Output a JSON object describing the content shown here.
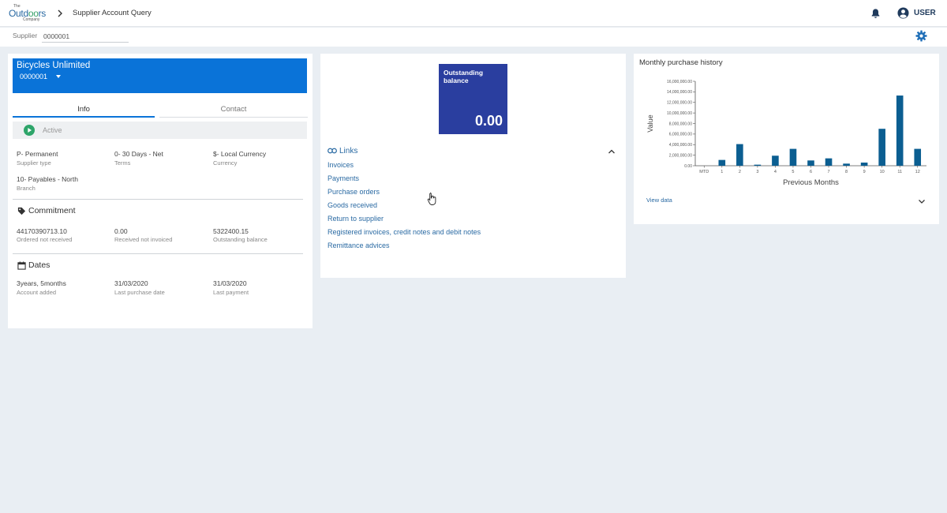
{
  "header": {
    "logo_small": "The",
    "logo_main_a": "Outd",
    "logo_main_b": "oo",
    "logo_main_c": "rs",
    "logo_sub": "Company",
    "page_title": "Supplier Account Query",
    "user_label": "USER"
  },
  "supplier_bar": {
    "label": "Supplier",
    "value": "0000001"
  },
  "supplier": {
    "name": "Bicycles Unlimited",
    "id": "0000001",
    "tabs": [
      {
        "label": "Info"
      },
      {
        "label": "Contact"
      }
    ],
    "status": "Active",
    "fields": [
      {
        "value": "P- Permanent",
        "label": "Supplier type"
      },
      {
        "value": "0- 30 Days - Net",
        "label": "Terms"
      },
      {
        "value": "$- Local Currency",
        "label": "Currency"
      },
      {
        "value": "10- Payables - North",
        "label": "Branch"
      }
    ],
    "commitment": {
      "title": "Commitment",
      "items": [
        {
          "value": "44170390713.10",
          "label": "Ordered not received"
        },
        {
          "value": "0.00",
          "label": "Received not invoiced"
        },
        {
          "value": "5322400.15",
          "label": "Outstanding balance"
        }
      ]
    },
    "dates": {
      "title": "Dates",
      "items": [
        {
          "value": "3years, 5months",
          "label": "Account added"
        },
        {
          "value": "31/03/2020",
          "label": "Last purchase date"
        },
        {
          "value": "31/03/2020",
          "label": "Last payment"
        }
      ]
    }
  },
  "balance": {
    "title": "Outstanding balance",
    "value": "0.00",
    "color": "#2a3e9f"
  },
  "links": {
    "title": "Links",
    "items": [
      {
        "label": "Invoices"
      },
      {
        "label": "Payments"
      },
      {
        "label": "Purchase orders"
      },
      {
        "label": "Goods received"
      },
      {
        "label": "Return to supplier"
      },
      {
        "label": "Registered invoices, credit notes and debit notes"
      },
      {
        "label": "Remittance advices"
      }
    ]
  },
  "history": {
    "title": "Monthly purchase history",
    "view_data_label": "View data"
  },
  "chart_data": {
    "type": "bar",
    "title": "Monthly purchase history",
    "xlabel": "Previous Months",
    "ylabel": "Value",
    "categories": [
      "MTD",
      "1",
      "2",
      "3",
      "4",
      "5",
      "6",
      "7",
      "8",
      "9",
      "10",
      "11",
      "12"
    ],
    "values": [
      0,
      1100000,
      4100000,
      200000,
      1900000,
      3200000,
      1000000,
      1400000,
      400000,
      600000,
      7000000,
      13300000,
      3200000
    ],
    "ylim": [
      0,
      16000000
    ],
    "yticks": [
      "0.00",
      "2,000,000.00",
      "4,000,000.00",
      "6,000,000.00",
      "8,000,000.00",
      "10,000,000.00",
      "12,000,000.00",
      "14,000,000.00",
      "16,000,000.00"
    ],
    "bar_color": "#0b5e91",
    "grid": false
  },
  "colors": {
    "accent": "#0a73d8",
    "link": "#2a6aa3",
    "active_green": "#2ea56a"
  }
}
